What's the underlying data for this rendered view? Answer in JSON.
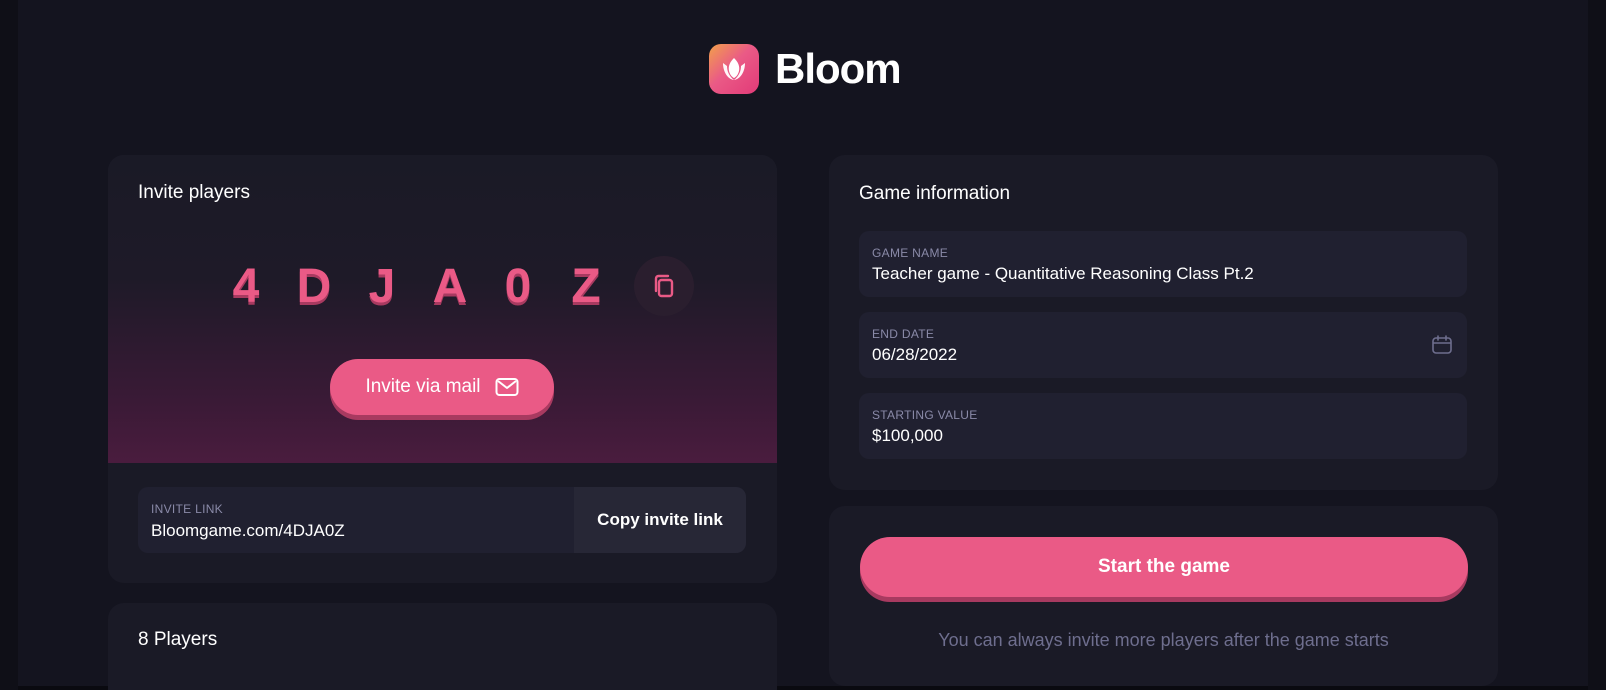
{
  "app": {
    "name": "Bloom"
  },
  "invite": {
    "title": "Invite players",
    "code_chars": [
      "4",
      "D",
      "J",
      "A",
      "0",
      "Z"
    ],
    "mail_button_label": "Invite via mail",
    "link_label": "INVITE LINK",
    "link_value": "Bloomgame.com/4DJA0Z",
    "copy_link_label": "Copy invite link"
  },
  "players": {
    "title": "8 Players"
  },
  "game_info": {
    "title": "Game information",
    "name_label": "GAME NAME",
    "name_value": "Teacher game - Quantitative Reasoning Class Pt.2",
    "end_date_label": "END DATE",
    "end_date_value": "06/28/2022",
    "starting_value_label": "STARTING VALUE",
    "starting_value_value": "$100,000"
  },
  "start": {
    "button_label": "Start the game",
    "note": "You can always invite more players after the game starts"
  },
  "icons": {
    "logo": "tulip-logo-icon",
    "copy_code": "copy-icon",
    "mail": "mail-icon",
    "calendar": "calendar-icon"
  },
  "colors": {
    "accent": "#ea5a86",
    "background": "#14141f",
    "card": "#1a1a26",
    "field": "#202030",
    "muted_text": "#6e6e8e"
  }
}
